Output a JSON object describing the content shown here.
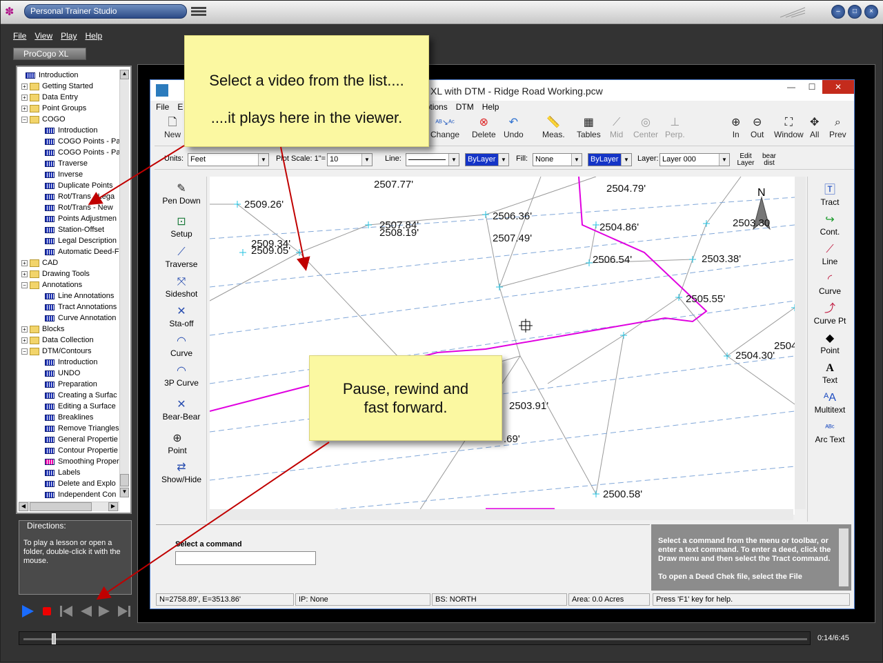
{
  "app": {
    "title": "Personal Trainer Studio",
    "tab": "ProCogo XL"
  },
  "menu": [
    "File",
    "View",
    "Play",
    "Help"
  ],
  "tree": [
    {
      "label": "Introduction",
      "kind": "film",
      "level": 1
    },
    {
      "label": "Getting Started",
      "kind": "folder",
      "level": 0,
      "exp": "+"
    },
    {
      "label": "Data Entry",
      "kind": "folder",
      "level": 0,
      "exp": "+"
    },
    {
      "label": "Point Groups",
      "kind": "folder",
      "level": 0,
      "exp": "+"
    },
    {
      "label": "COGO",
      "kind": "folder",
      "level": 0,
      "exp": "−"
    },
    {
      "label": "Introduction",
      "kind": "film",
      "level": 2
    },
    {
      "label": "COGO Points - Pa",
      "kind": "film",
      "level": 2
    },
    {
      "label": "COGO Points - Pa",
      "kind": "film",
      "level": 2
    },
    {
      "label": "Traverse",
      "kind": "film",
      "level": 2
    },
    {
      "label": "Inverse",
      "kind": "film",
      "level": 2
    },
    {
      "label": "Duplicate Points",
      "kind": "film",
      "level": 2
    },
    {
      "label": "Rot/Trans - Lega",
      "kind": "film",
      "level": 2
    },
    {
      "label": "Rot/Trans - New",
      "kind": "film",
      "level": 2
    },
    {
      "label": "Points Adjustmen",
      "kind": "film",
      "level": 2
    },
    {
      "label": "Station-Offset",
      "kind": "film",
      "level": 2
    },
    {
      "label": "Legal Description",
      "kind": "film",
      "level": 2
    },
    {
      "label": "Automatic Deed-F",
      "kind": "film",
      "level": 2
    },
    {
      "label": "CAD",
      "kind": "folder",
      "level": 0,
      "exp": "+"
    },
    {
      "label": "Drawing Tools",
      "kind": "folder",
      "level": 0,
      "exp": "+"
    },
    {
      "label": "Annotations",
      "kind": "folder",
      "level": 0,
      "exp": "−"
    },
    {
      "label": "Line Annotations",
      "kind": "film",
      "level": 2
    },
    {
      "label": "Tract Annotations",
      "kind": "film",
      "level": 2
    },
    {
      "label": "Curve Annotation",
      "kind": "film",
      "level": 2
    },
    {
      "label": "Blocks",
      "kind": "folder",
      "level": 0,
      "exp": "+"
    },
    {
      "label": "Data Collection",
      "kind": "folder",
      "level": 0,
      "exp": "+"
    },
    {
      "label": "DTM/Contours",
      "kind": "folder",
      "level": 0,
      "exp": "−"
    },
    {
      "label": "Introduction",
      "kind": "film",
      "level": 2
    },
    {
      "label": "UNDO",
      "kind": "film",
      "level": 2
    },
    {
      "label": "Preparation",
      "kind": "film",
      "level": 2
    },
    {
      "label": "Creating a Surfac",
      "kind": "film",
      "level": 2
    },
    {
      "label": "Editing a Surface",
      "kind": "film",
      "level": 2
    },
    {
      "label": "Breaklines",
      "kind": "film",
      "level": 2
    },
    {
      "label": "Remove Triangles",
      "kind": "film",
      "level": 2
    },
    {
      "label": "General Propertie",
      "kind": "film",
      "level": 2
    },
    {
      "label": "Contour Propertie",
      "kind": "film",
      "level": 2
    },
    {
      "label": "Smoothing Proper",
      "kind": "film-pink",
      "level": 2
    },
    {
      "label": "Labels",
      "kind": "film",
      "level": 2
    },
    {
      "label": "Delete and Explo",
      "kind": "film",
      "level": 2
    },
    {
      "label": "Independent Con",
      "kind": "film",
      "level": 2
    }
  ],
  "directions": {
    "label": "Directions:",
    "text": "To play a lesson or open a folder, double-click it with the mouse."
  },
  "player": {
    "time": "0:14/6:45",
    "progress": 0.036
  },
  "viewer": {
    "title": "XL with DTM - Ridge Road Working.pcw",
    "menu": [
      "File",
      "E",
      "Options",
      "DTM",
      "Help"
    ],
    "toolbar": [
      "New",
      "Change",
      "Delete",
      "Undo",
      "Meas.",
      "Tables",
      "Mid",
      "Center",
      "Perp.",
      "In",
      "Out",
      "Window",
      "All",
      "Prev"
    ],
    "props": {
      "units_label": "Units:",
      "units": "Feet",
      "plot_label": "Plot Scale: 1\"=",
      "plot": "10",
      "line_label": "Line:",
      "line_layer": "ByLayer",
      "fill_label": "Fill:",
      "fill": "None",
      "fill_layer": "ByLayer",
      "layer_label": "Layer:",
      "layer": "Layer 000",
      "edit_layer": "Edit Layer",
      "bear_dist": "bear dist"
    },
    "left_tools": [
      "Pen Down",
      "Setup",
      "Traverse",
      "Sideshot",
      "Sta-off",
      "Curve",
      "3P Curve",
      "Bear-Bear",
      "Point",
      "Show/Hide"
    ],
    "right_tools": [
      "Tract",
      "Cont.",
      "Line",
      "Curve",
      "Curve Pt",
      "Point",
      "Text",
      "Multitext",
      "Arc Text"
    ],
    "elevations": [
      "2507.77'",
      "2504.79'",
      "2509.26'",
      "2506.36'",
      "2507.84'",
      "2508.19'",
      "2504.86'",
      "2503.30",
      "2509.34'",
      "2509.05'",
      "2507.49'",
      "2506.54'",
      "2503.38'",
      "2505.55'",
      "2504",
      "2504.30'",
      "2503.91'",
      ".69'",
      "2500.58'"
    ],
    "north": "N",
    "command_label": "Select a command",
    "help_text": "Select a command from the menu or toolbar, or enter a text command. To enter a deed, click the Draw menu and then select the Tract command.",
    "help_text2": "To open a Deed Chek file, select the File",
    "status": [
      "N=2758.89',  E=3513.86'",
      "IP: None",
      "BS: NORTH",
      "Area: 0.0 Acres",
      "Press 'F1' key  for help."
    ]
  },
  "callouts": {
    "top_line1": "Select a video from the list....",
    "top_line2": "....it plays here in the viewer.",
    "bottom_line1": "Pause, rewind and",
    "bottom_line2": "fast forward."
  }
}
